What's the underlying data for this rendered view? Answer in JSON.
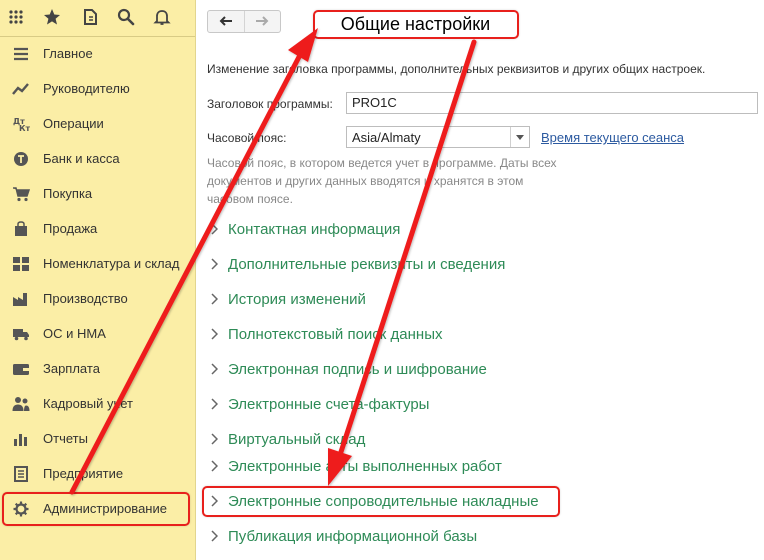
{
  "topbar": {
    "icons": [
      "apps-grid-icon",
      "star-icon",
      "history-icon",
      "search-icon",
      "bell-icon"
    ]
  },
  "sidebar": {
    "items": [
      {
        "label": "Главное",
        "icon": "menu-lines-icon"
      },
      {
        "label": "Руководителю",
        "icon": "trend-icon"
      },
      {
        "label": "Операции",
        "icon": "debit-credit-icon"
      },
      {
        "label": "Банк и касса",
        "icon": "coin-icon"
      },
      {
        "label": "Покупка",
        "icon": "cart-icon"
      },
      {
        "label": "Продажа",
        "icon": "bag-icon"
      },
      {
        "label": "Номенклатура и склад",
        "icon": "blocks-icon"
      },
      {
        "label": "Производство",
        "icon": "factory-icon"
      },
      {
        "label": "ОС и НМА",
        "icon": "truck-icon"
      },
      {
        "label": "Зарплата",
        "icon": "wallet-icon"
      },
      {
        "label": "Кадровый учет",
        "icon": "people-icon"
      },
      {
        "label": "Отчеты",
        "icon": "bar-chart-icon"
      },
      {
        "label": "Предприятие",
        "icon": "building-icon"
      },
      {
        "label": "Администрирование",
        "icon": "gear-icon",
        "active": true
      }
    ]
  },
  "header": {
    "back_icon": "arrow-left-icon",
    "forward_icon": "arrow-right-icon",
    "title": "Общие настройки"
  },
  "main": {
    "description": "Изменение заголовка программы, дополнительных реквизитов и других общих настроек.",
    "title_field": {
      "label": "Заголовок программы:",
      "value": "PRO1C"
    },
    "timezone_field": {
      "label": "Часовой пояс:",
      "value": "Asia/Almaty"
    },
    "session_time_link": "Время текущего сеанса",
    "hint_lines": [
      "Часовой пояс, в котором ведется учет в программе. Даты всех",
      "документов и других данных вводятся и хранятся в этом",
      "часовом поясе."
    ],
    "sections": [
      "Контактная информация",
      "Дополнительные реквизиты и сведения",
      "История изменений",
      "Полнотекстовый поиск данных",
      "Электронная подпись и шифрование",
      "Электронные счета-фактуры",
      "Виртуальный склад",
      "Электронные акты выполненных работ",
      "Электронные сопроводительные накладные",
      "Публикация информационной базы"
    ]
  },
  "colors": {
    "sidebar_bg": "#fbeea6",
    "section_link": "#2e8b57",
    "highlight": "#e8201c",
    "link": "#2c5aa0"
  }
}
